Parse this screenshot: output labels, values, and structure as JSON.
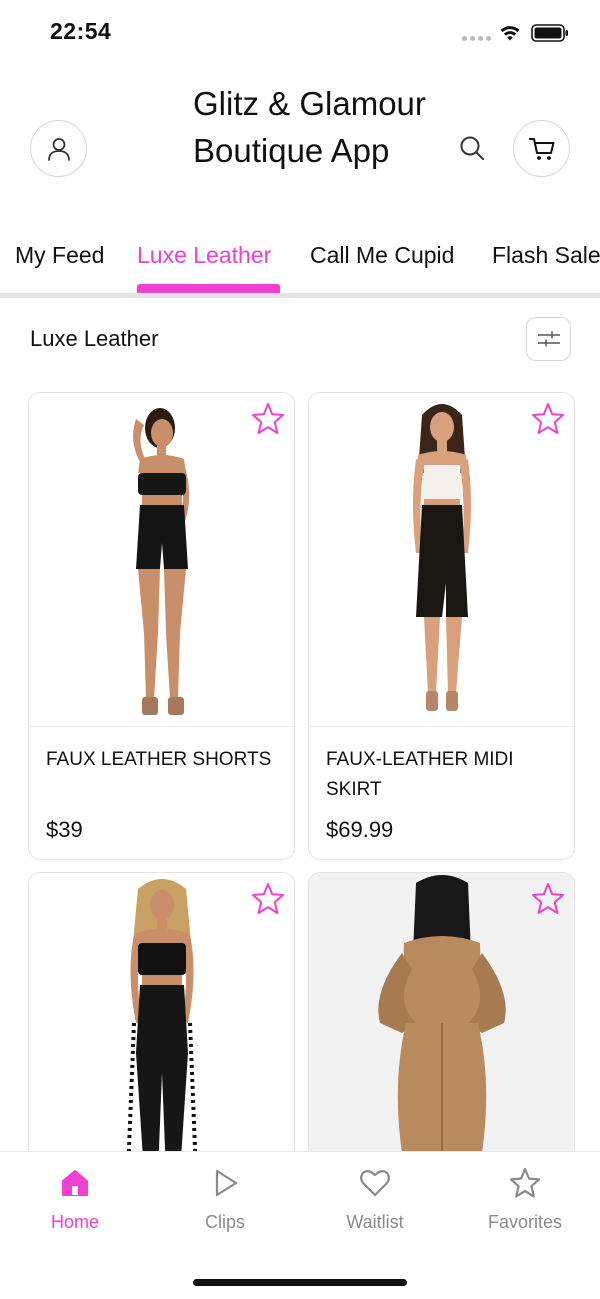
{
  "status_bar": {
    "time": "22:54"
  },
  "header": {
    "title": "Glitz & Glamour Boutique App"
  },
  "tabs": [
    {
      "label": "My Feed",
      "active": false
    },
    {
      "label": "Luxe Leather",
      "active": true
    },
    {
      "label": "Call Me Cupid",
      "active": false
    },
    {
      "label": "Flash Sale",
      "active": false
    }
  ],
  "section": {
    "title": "Luxe Leather"
  },
  "products": [
    {
      "name": "FAUX LEATHER SHORTS",
      "price": "$39",
      "image": "model in black leather tube top and shorts"
    },
    {
      "name": "FAUX-LEATHER MIDI SKIRT",
      "price": "$69.99",
      "image": "model in white crop top and black leather midi skirt"
    },
    {
      "name": "",
      "price": "",
      "image": "model in black tube top and fringed leather pants"
    },
    {
      "name": "",
      "price": "",
      "image": "model in tan leather long-sleeve dress, back view"
    }
  ],
  "bottom_nav": [
    {
      "label": "Home",
      "icon": "home-icon",
      "active": true
    },
    {
      "label": "Clips",
      "icon": "play-icon",
      "active": false
    },
    {
      "label": "Waitlist",
      "icon": "heart-icon",
      "active": false
    },
    {
      "label": "Favorites",
      "icon": "star-icon",
      "active": false
    }
  ],
  "colors": {
    "accent": "#f040d0",
    "text": "#111111",
    "muted": "#8a8a8a",
    "border": "#e2e2e2"
  }
}
